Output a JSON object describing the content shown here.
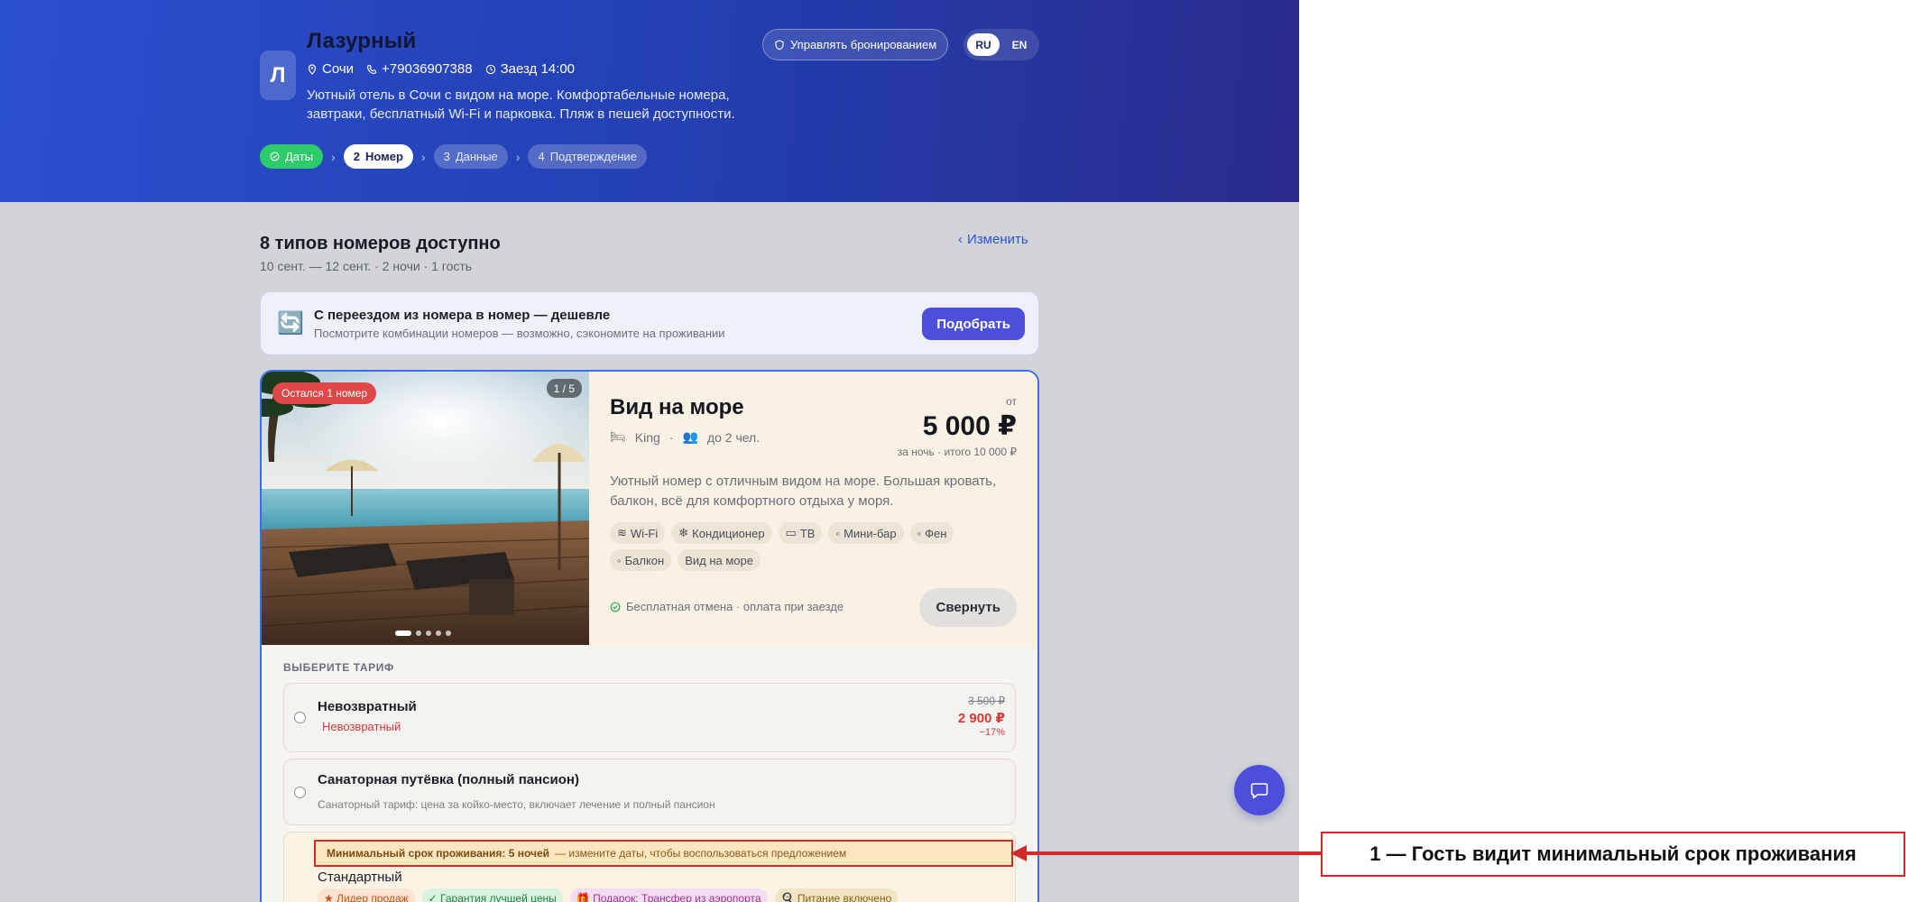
{
  "hotel": {
    "avatar_letter": "Л",
    "name": "Лазурный",
    "city": "Сочи",
    "phone": "+79036907388",
    "checkin": "Заезд 14:00",
    "description": "Уютный отель в Сочи с видом на море. Комфортабельные номера, завтраки, бесплатный Wi‑Fi и парковка. Пляж в пешей доступности."
  },
  "header": {
    "manage_label": "Управлять бронированием",
    "langs": [
      "RU",
      "EN"
    ],
    "active_lang": "RU"
  },
  "steps": [
    {
      "num": "",
      "label": "Даты",
      "state": "done"
    },
    {
      "num": "2",
      "label": "Номер",
      "state": "current"
    },
    {
      "num": "3",
      "label": "Данные",
      "state": "upcoming"
    },
    {
      "num": "4",
      "label": "Подтверждение",
      "state": "upcoming"
    }
  ],
  "results": {
    "title": "8 типов номеров доступно",
    "subtitle": "10 сент. — 12 сент. · 2 ночи · 1 гость",
    "change_label": "Изменить"
  },
  "promo": {
    "icon": "🔄",
    "title": "С переездом из номера в номер — дешевле",
    "subtitle": "Посмотрите комбинации номеров — возможно, сэкономите на проживании",
    "button": "Подобрать"
  },
  "room": {
    "availability": "Остался 1 номер",
    "photo_counter": "1 / 5",
    "photo_count": 5,
    "photo_active": 1,
    "name": "Вид на море",
    "bed": "King",
    "capacity": "до 2 чел.",
    "price_from": "от",
    "price": "5 000 ₽",
    "price_note": "за ночь · итого 10 000 ₽",
    "description": "Уютный номер с отличным видом на море. Большая кровать, балкон, всё для комфортного отдыха у моря.",
    "amenities": [
      {
        "icon": "wifi-icon",
        "label": "Wi‑Fi"
      },
      {
        "icon": "snowflake-icon",
        "label": "Кондиционер"
      },
      {
        "icon": "tv-icon",
        "label": "ТВ"
      },
      {
        "icon": "minibar-icon",
        "label": "Мини-бар"
      },
      {
        "icon": "hairdryer-icon",
        "label": "Фен"
      },
      {
        "icon": "balcony-icon",
        "label": "Балкон"
      },
      {
        "icon": "",
        "label": "Вид на море"
      }
    ],
    "cancel_note": "Бесплатная отмена · оплата при заезде",
    "collapse_label": "Свернуть"
  },
  "tariffs": {
    "heading": "ВЫБЕРИТЕ ТАРИФ",
    "items": [
      {
        "name": "Невозвратный",
        "tag": "Невозвратный",
        "old_price": "3 500 ₽",
        "new_price": "2 900 ₽",
        "discount": "−17%"
      },
      {
        "name": "Санаторная путёвка (полный пансион)",
        "note": "Санаторный тариф: цена за койко-место, включает лечение и полный пансион"
      },
      {
        "minstay_bold": "Минимальный срок проживания: 5 ночей",
        "minstay_rest": "— измените даты, чтобы воспользоваться предложением",
        "name": "Стандартный",
        "tags": [
          {
            "kind": "leader",
            "label": "★ Лидер продаж"
          },
          {
            "kind": "guarantee",
            "label": "✓ Гарантия лучшей цены"
          },
          {
            "kind": "gift",
            "label": "🎁 Подарок: Трансфер из аэропорта"
          },
          {
            "kind": "food",
            "label": "🍳 Питание включено"
          }
        ]
      }
    ]
  },
  "annotation": {
    "label": "1 — Гость видит минимальный срок проживания",
    "color": "#d42a2a"
  },
  "colors": {
    "brand": "#2a4fd0",
    "accent_button": "#4b4fdb",
    "danger": "#d4393b",
    "success": "#2ecb6a"
  }
}
